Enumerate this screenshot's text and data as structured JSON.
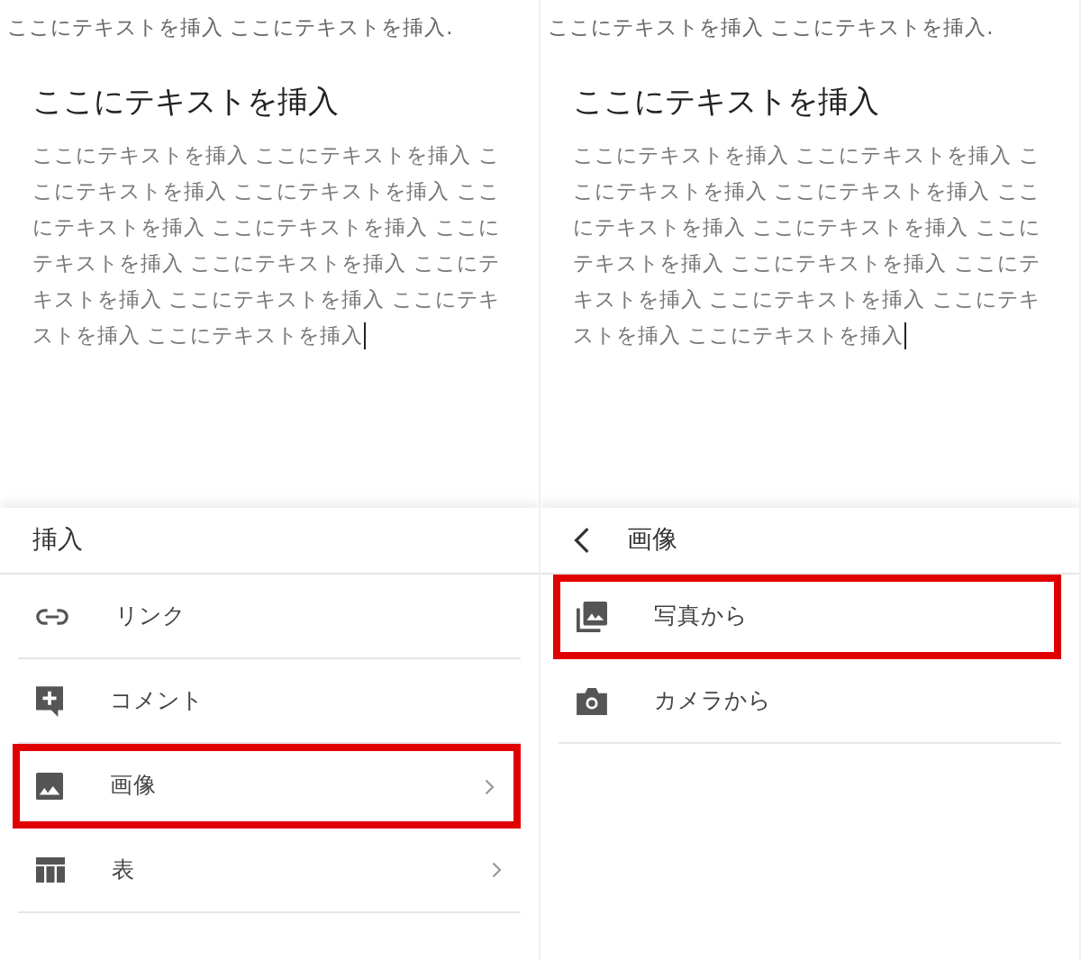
{
  "panels": [
    {
      "document": {
        "top_line": "ここにテキストを挿入 ここにテキストを挿入.",
        "heading": "ここにテキストを挿入",
        "paragraph": "ここにテキストを挿入 ここにテキストを挿入 ここにテキストを挿入 ここにテキストを挿入 ここにテキストを挿入 ここにテキストを挿入 ここにテキストを挿入 ここにテキストを挿入 ここにテキストを挿入 ここにテキストを挿入 ここにテキストを挿入 ここにテキストを挿入"
      },
      "sheet": {
        "title": "挿入",
        "back": false,
        "items": [
          {
            "kind": "link",
            "label": "リンク",
            "chevron": false,
            "highlighted": false
          },
          {
            "kind": "comment",
            "label": "コメント",
            "chevron": false,
            "highlighted": false
          },
          {
            "kind": "image",
            "label": "画像",
            "chevron": true,
            "highlighted": true
          },
          {
            "kind": "table",
            "label": "表",
            "chevron": true,
            "highlighted": false
          }
        ]
      }
    },
    {
      "document": {
        "top_line": "ここにテキストを挿入 ここにテキストを挿入.",
        "heading": "ここにテキストを挿入",
        "paragraph": "ここにテキストを挿入 ここにテキストを挿入 ここにテキストを挿入 ここにテキストを挿入 ここにテキストを挿入 ここにテキストを挿入 ここにテキストを挿入 ここにテキストを挿入 ここにテキストを挿入 ここにテキストを挿入 ここにテキストを挿入 ここにテキストを挿入"
      },
      "sheet": {
        "title": "画像",
        "back": true,
        "items": [
          {
            "kind": "photos",
            "label": "写真から",
            "chevron": false,
            "highlighted": true
          },
          {
            "kind": "camera",
            "label": "カメラから",
            "chevron": false,
            "highlighted": false
          }
        ]
      }
    }
  ]
}
